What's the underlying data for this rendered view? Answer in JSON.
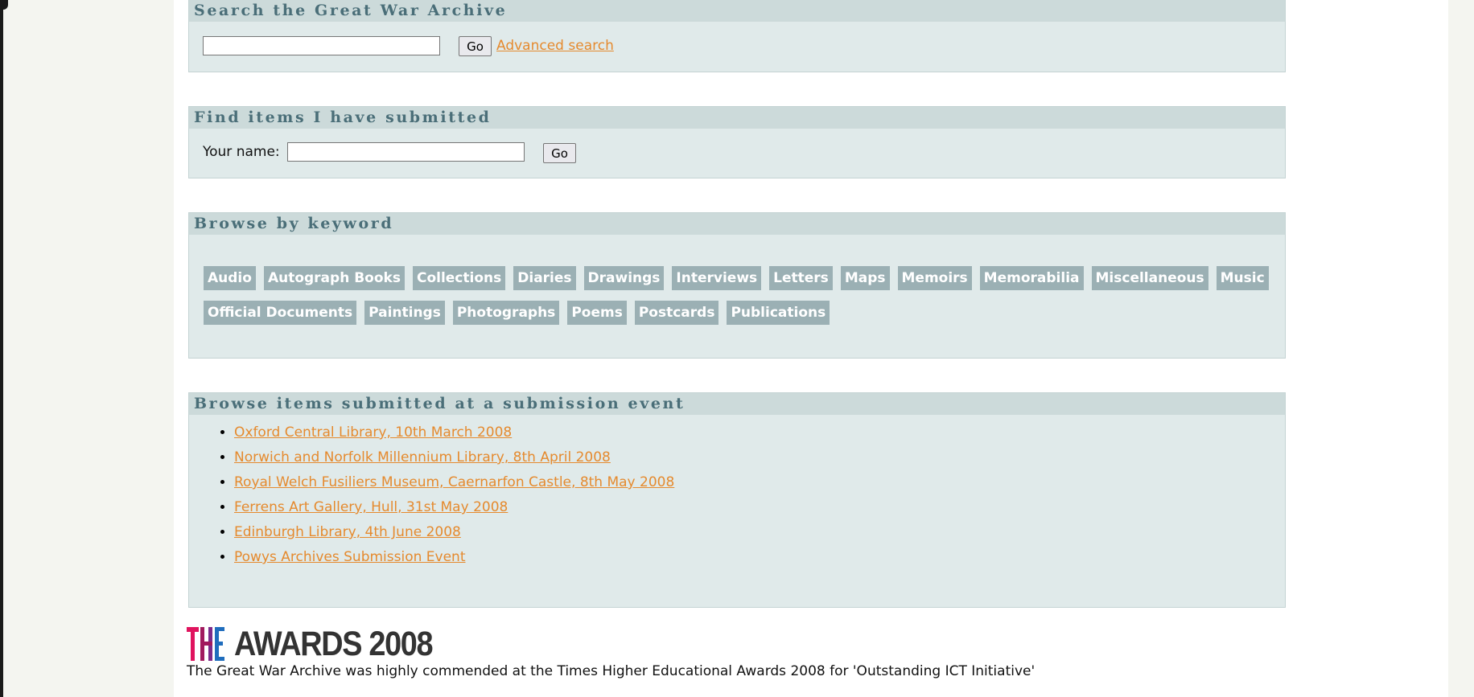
{
  "search": {
    "title": "Search the Great War Archive",
    "input_value": "",
    "go_label": "Go",
    "advanced_label": "Advanced search"
  },
  "find": {
    "title": "Find items I have submitted",
    "name_label": "Your name:",
    "input_value": "",
    "go_label": "Go"
  },
  "keywords": {
    "title": "Browse by keyword",
    "row1": [
      "Audio",
      "Autograph Books",
      "Collections",
      "Diaries",
      "Drawings",
      "Interviews",
      "Letters",
      "Maps",
      "Memoirs",
      "Memorabilia",
      "Miscellaneous",
      "Music"
    ],
    "row2": [
      "Official Documents",
      "Paintings",
      "Photographs",
      "Poems",
      "Postcards",
      "Publications"
    ]
  },
  "events": {
    "title": "Browse items submitted at a submission event",
    "items": [
      "Oxford Central Library, 10th March 2008",
      "Norwich and Norfolk Millennium Library, 8th April 2008",
      "Royal Welch Fusiliers Museum, Caernarfon Castle, 8th May 2008",
      "Ferrens Art Gallery, Hull, 31st May 2008",
      "Edinburgh Library, 4th June 2008",
      "Powys Archives Submission Event"
    ]
  },
  "awards": {
    "logo_the": "THE",
    "logo_rest": "AWARDS 2008",
    "caption": "The Great War Archive was highly commended at the Times Higher Educational Awards 2008 for 'Outstanding ICT Initiative'"
  },
  "colors": {
    "link": "#e58a2e",
    "box_bg": "#e0eaea",
    "box_header": "#ccdada",
    "keyword_bg": "#9bb0b4"
  }
}
